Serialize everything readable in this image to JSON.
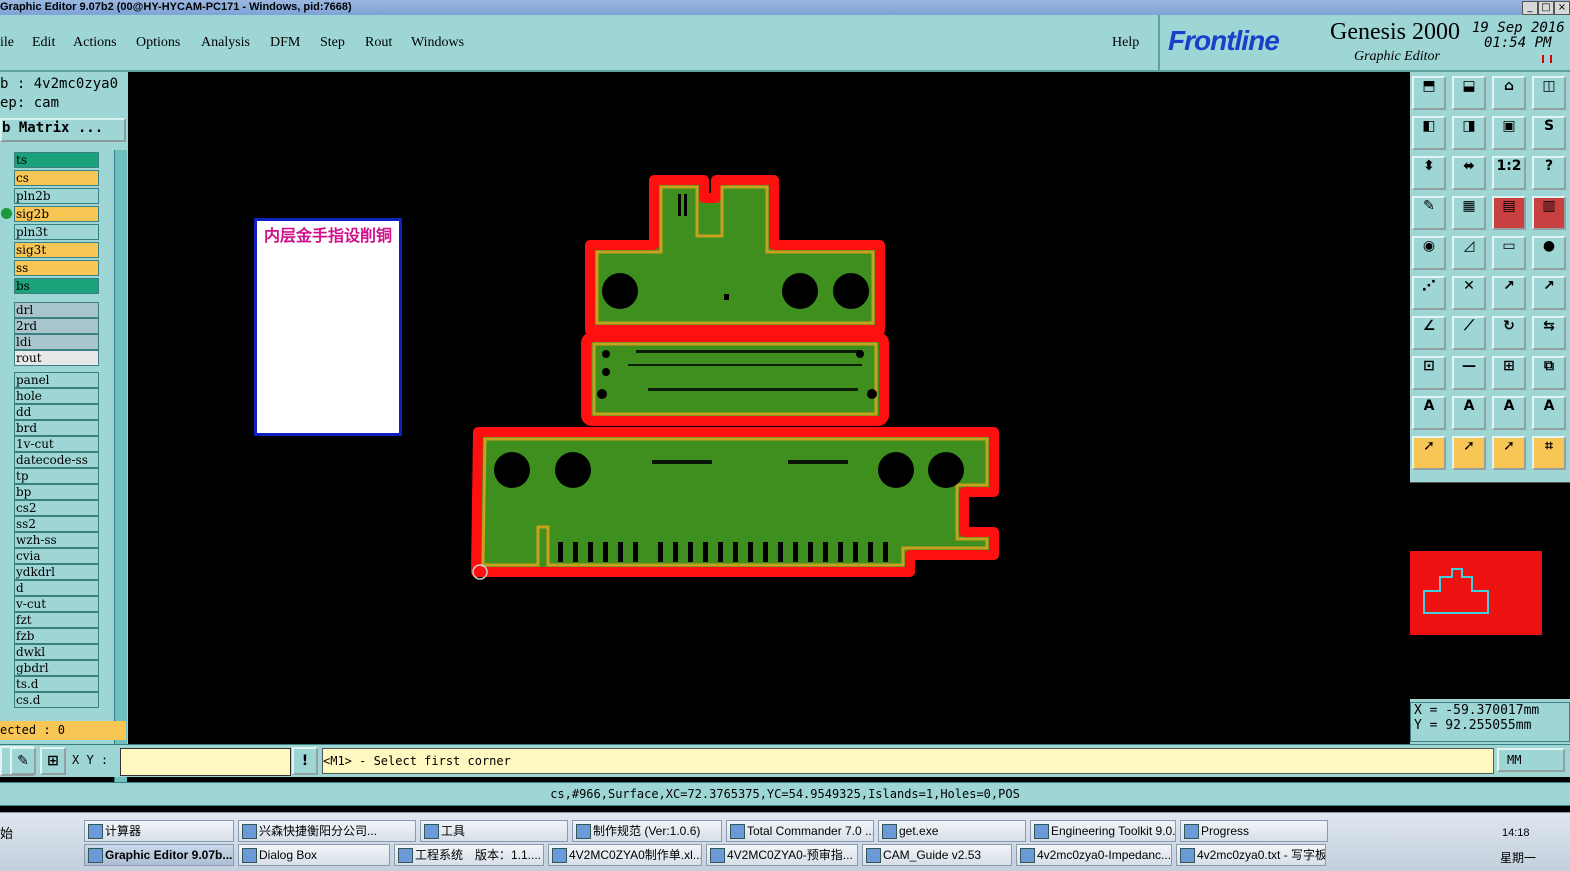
{
  "window": {
    "title": "Graphic Editor 9.07b2 (00@HY-HYCAM-PC171 - Windows, pid:7668)",
    "controls": [
      "_",
      "□",
      "×"
    ]
  },
  "menu": {
    "items": [
      "ile",
      "Edit",
      "Actions",
      "Options",
      "Analysis",
      "DFM",
      "Step",
      "Rout",
      "Windows"
    ],
    "help": "Help"
  },
  "brand": {
    "logo": "Frontline",
    "product": "Genesis 2000",
    "subtitle": "Graphic Editor",
    "date": "19 Sep 2016",
    "time": "01:54 PM",
    "colors": {
      "logo": "#1a3fc9",
      "panel": "#9ed6d6"
    }
  },
  "job": {
    "job_line": "b : 4v2mc0zya0",
    "step_line": "ep: cam",
    "matrix_button": "b Matrix ...",
    "selected_line": "ected : 0"
  },
  "layers": [
    {
      "name": "ts",
      "color": "#1aa37a"
    },
    {
      "name": "cs",
      "color": "#f7c654"
    },
    {
      "name": "pln2b",
      "color": "#9ed6d6"
    },
    {
      "name": "sig2b",
      "color": "#f7c654"
    },
    {
      "name": "pln3t",
      "color": "#9ed6d6"
    },
    {
      "name": "sig3t",
      "color": "#f7c654"
    },
    {
      "name": "ss",
      "color": "#f7c654"
    },
    {
      "name": "bs",
      "color": "#1aa37a"
    },
    {
      "name": "drl",
      "color": "#a8c4cc"
    },
    {
      "name": "2rd",
      "color": "#a8c4cc"
    },
    {
      "name": "ldi",
      "color": "#a8c4cc"
    },
    {
      "name": "rout",
      "color": "#e8e8e8"
    },
    {
      "name": "panel",
      "color": "#9ed6d6"
    },
    {
      "name": "hole",
      "color": "#9ed6d6"
    },
    {
      "name": "dd",
      "color": "#9ed6d6"
    },
    {
      "name": "brd",
      "color": "#9ed6d6"
    },
    {
      "name": "1v-cut",
      "color": "#9ed6d6"
    },
    {
      "name": "datecode-ss",
      "color": "#9ed6d6"
    },
    {
      "name": "tp",
      "color": "#9ed6d6"
    },
    {
      "name": "bp",
      "color": "#9ed6d6"
    },
    {
      "name": "cs2",
      "color": "#9ed6d6"
    },
    {
      "name": "ss2",
      "color": "#9ed6d6"
    },
    {
      "name": "wzh-ss",
      "color": "#9ed6d6"
    },
    {
      "name": "cvia",
      "color": "#9ed6d6"
    },
    {
      "name": "ydkdrl",
      "color": "#9ed6d6"
    },
    {
      "name": "d",
      "color": "#9ed6d6"
    },
    {
      "name": "v-cut",
      "color": "#9ed6d6"
    },
    {
      "name": "fzt",
      "color": "#9ed6d6"
    },
    {
      "name": "fzb",
      "color": "#9ed6d6"
    },
    {
      "name": "dwkl",
      "color": "#9ed6d6"
    },
    {
      "name": "gbdrl",
      "color": "#9ed6d6"
    },
    {
      "name": "ts.d",
      "color": "#9ed6d6"
    },
    {
      "name": "cs.d",
      "color": "#9ed6d6"
    }
  ],
  "active_layer_marker": "sig2b",
  "canvas": {
    "note_text": "内层金手指设削铜",
    "colors": {
      "board_fill": "#3f8f1e",
      "outline": "#ff1010",
      "edge": "#c8a020",
      "background": "#000000"
    }
  },
  "toolbar_icons": [
    "zoom-home-icon",
    "zoom-page-icon",
    "home-icon",
    "view-icon",
    "pan-left-icon",
    "pan-right-icon",
    "zoom-fit-icon",
    "snap-icon",
    "zoom-in-icon",
    "zoom-out-icon",
    "scale-icon",
    "query-icon",
    "measure-icon",
    "grid-icon",
    "layer-a-icon",
    "layer-b-icon",
    "pad-icon",
    "line-icon",
    "ruler-icon",
    "dot-icon",
    "connect-icon",
    "cross-icon",
    "move-icon",
    "copy-icon",
    "slant-icon",
    "diag-icon",
    "rotate-icon",
    "mirror-icon",
    "resize-icon",
    "minus-icon",
    "frame-icon",
    "group-icon",
    "text-a-icon",
    "text-b-icon",
    "text-c-icon",
    "text-d-icon",
    "pointer-icon",
    "select-icon",
    "box-select-icon",
    "net-icon"
  ],
  "toolbar_glyphs": [
    "⬒",
    "⬓",
    "⌂",
    "◫",
    "◧",
    "◨",
    "▣",
    "S",
    "⬍",
    "⬌",
    "1:2",
    "?",
    "✎",
    "▦",
    "▤",
    "▥",
    "◉",
    "◿",
    "▭",
    "●",
    "⋰",
    "✕",
    "↗",
    "↗",
    "∠",
    "⟋",
    "↻",
    "⇆",
    "⊡",
    "—",
    "⊞",
    "⧉",
    "A",
    "A",
    "A",
    "A",
    "➚",
    "➚",
    "➚",
    "⌗"
  ],
  "preview": {
    "colors": {
      "fill": "#ee1111",
      "outline": "#40d0e0"
    }
  },
  "coords": {
    "x": "X = -59.370017mm",
    "y": "Y = 92.255055mm"
  },
  "command_bar": {
    "xy_label": "X Y :",
    "xy_value": "",
    "prompt": "<M1> - Select first corner",
    "unit": "MM",
    "warn_icon": "!"
  },
  "status": "cs,#966,Surface,XC=72.3765375,YC=54.9549325,Islands=1,Holes=0,POS",
  "taskbar": {
    "start": "始",
    "row1": [
      "计算器",
      "兴森快捷衡阳分公司...",
      "工具",
      "制作规范 (Ver:1.0.6)",
      "Total Commander 7.0 ...",
      "get.exe",
      "Engineering Toolkit 9.0...",
      "Progress"
    ],
    "row2": [
      "Graphic Editor 9.07b...",
      "Dialog Box",
      "工程系统　版本：1.1....",
      "4V2MC0ZYA0制作单.xl...",
      "4V2MC0ZYA0-预审指...",
      "CAM_Guide v2.53",
      "4v2mc0zya0-Impedanc...",
      "4v2mc0zya0.txt - 写字板"
    ],
    "clock": "14:18",
    "weekday": "星期一"
  }
}
